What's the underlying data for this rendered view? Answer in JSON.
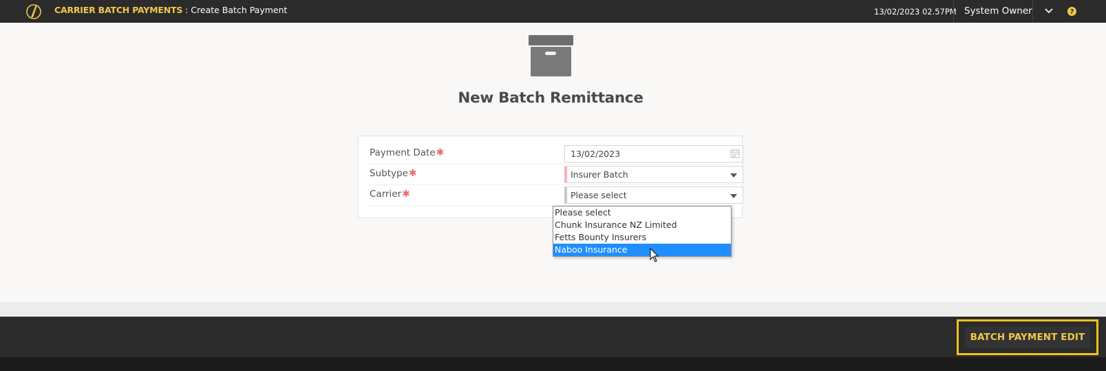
{
  "header": {
    "module": "CARRIER BATCH PAYMENTS",
    "separator": " : ",
    "page": "Create Batch Payment",
    "datetime": "13/02/2023 02.57PM",
    "user": "System Owner",
    "icons": {
      "logo": "app-logo-icon",
      "menu": "chevron-down-icon",
      "help": "help-icon"
    }
  },
  "main": {
    "title": "New Batch Remittance",
    "icon": "archive-box-icon"
  },
  "form": {
    "fields": [
      {
        "label": "Payment Date",
        "value": "13/02/2023",
        "required": true
      },
      {
        "label": "Subtype",
        "value": "Insurer Batch",
        "required": true
      },
      {
        "label": "Carrier",
        "value": "Please select",
        "required": true
      }
    ],
    "required_marker": "✱"
  },
  "carrier_dropdown": {
    "options": [
      "Please select",
      "Chunk Insurance NZ Limited",
      "Fetts Bounty Insurers",
      "Naboo Insurance"
    ],
    "highlighted": "Naboo Insurance"
  },
  "footer": {
    "batch_button": "BATCH PAYMENT EDIT"
  },
  "colors": {
    "accent": "#f0c84a",
    "topbar": "#2b2b2b",
    "highlight": "#1f8fff",
    "required": "#e96a6a"
  }
}
